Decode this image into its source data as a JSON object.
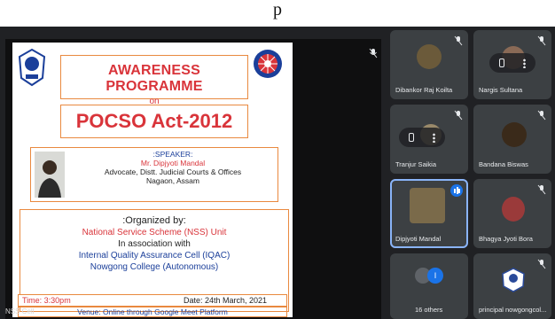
{
  "top_fragment": "p",
  "slide": {
    "title": "AWARENESS PROGRAMME",
    "title_on": "on",
    "act": "POCSO Act-2012",
    "speaker_heading": ":SPEAKER:",
    "speaker_name": "Mr. Dipjyoti Mandal",
    "speaker_designation": "Advocate, Distt. Judicial Courts & Offices",
    "speaker_place": "Nagaon, Assam",
    "organized_by": ":Organized by:",
    "org_unit": "National Service Scheme (NSS) Unit",
    "assoc": "In association with",
    "iqac": "Internal Quality Assurance Cell (IQAC)",
    "college": "Nowgong College (Autonomous)",
    "time": "Time: 3:30pm",
    "date": "Date: 24th March, 2021",
    "venue": "Venue: Online through Google Meet Platform"
  },
  "presenter_tag": "NSS Cell",
  "participants": [
    {
      "name": "Dibankor Raj Koilta",
      "avatar_color": "#6b5a3a"
    },
    {
      "name": "Nargis Sultana",
      "avatar_color": "#8a6a56"
    },
    {
      "name": "Tranjur Saikia",
      "avatar_color": "#9a8a6a"
    },
    {
      "name": "Bandana Biswas",
      "avatar_color": "#3a2a1a"
    },
    {
      "name": "Dipjyoti Mandal",
      "avatar_color": "#7a6a4a"
    },
    {
      "name": "Bhagya Jyoti Bora",
      "avatar_color": "#9a3a3a"
    },
    {
      "name": "16 others",
      "avatar_color": "#1a73e8"
    },
    {
      "name": "principal nowgongcol...",
      "avatar_color": "#2a4a9a"
    }
  ],
  "colors": {
    "meet_bg": "#202124",
    "tile_bg": "#3c4043",
    "accent_red": "#d9343a",
    "accent_orange": "#e9893f",
    "accent_blue": "#1b3f9a",
    "speaking": "#1a73e8"
  },
  "icons": [
    "mic-off-icon",
    "pin-icon",
    "more-vert-icon",
    "speaking-icon"
  ]
}
